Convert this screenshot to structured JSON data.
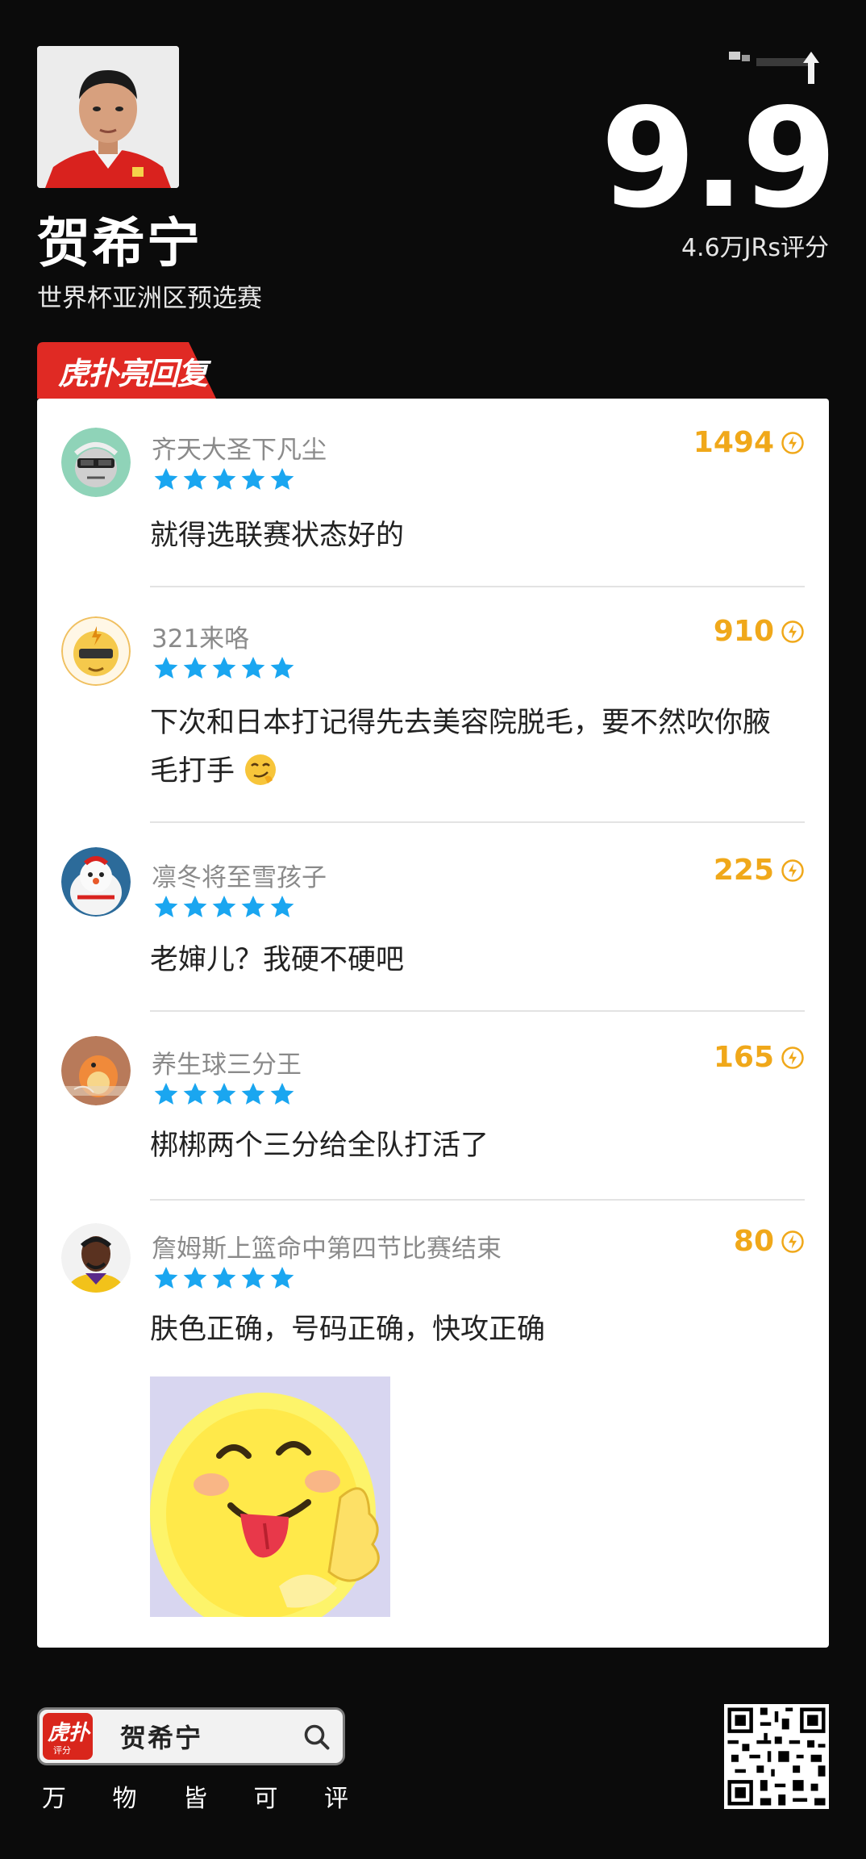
{
  "header": {
    "player_name": "贺希宁",
    "event": "世界杯亚洲区预选赛",
    "score": "9.9",
    "rating_count": "4.6万JRs评分"
  },
  "badge": {
    "label": "虎扑亮回复"
  },
  "comments": [
    {
      "user": "齐天大圣下凡尘",
      "likes": "1494",
      "stars": 5,
      "text": "就得选联赛状态好的"
    },
    {
      "user": "321来咯",
      "likes": "910",
      "stars": 5,
      "text": "下次和日本打记得先去美容院脱毛，要不然吹你腋毛打手"
    },
    {
      "user": "凛冬将至雪孩子",
      "likes": "225",
      "stars": 5,
      "text": "老婶儿？我硬不硬吧"
    },
    {
      "user": "养生球三分王",
      "likes": "165",
      "stars": 5,
      "text": "梆梆两个三分给全队打活了"
    },
    {
      "user": "詹姆斯上篮命中第四节比赛结束",
      "likes": "80",
      "stars": 5,
      "text": "肤色正确，号码正确，快攻正确"
    }
  ],
  "footer": {
    "app_icon_text": "虎扑",
    "app_icon_sub": "评分",
    "search_text": "贺希宁",
    "slogan": [
      "万",
      "物",
      "皆",
      "可",
      "评"
    ]
  },
  "colors": {
    "accent_red": "#e02a24",
    "like_gold": "#f0a81a",
    "star_blue": "#1aa6f0"
  }
}
